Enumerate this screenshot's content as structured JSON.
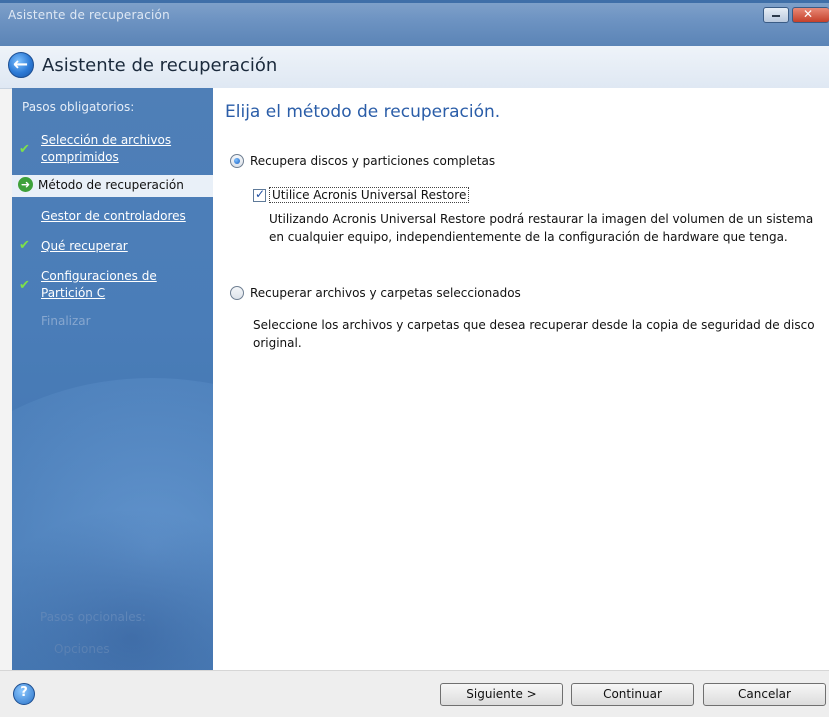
{
  "window": {
    "title": "Asistente de recuperación",
    "header_title": "Asistente de recuperación"
  },
  "sidebar": {
    "heading": "Pasos obligatorios:",
    "steps": [
      {
        "label": "Selección de archivos comprimidos",
        "state": "done"
      },
      {
        "label": "Método de recuperación",
        "state": "current"
      },
      {
        "label": "Gestor de controladores",
        "state": "link"
      },
      {
        "label": "Qué recuperar",
        "state": "done"
      },
      {
        "label": "Configuraciones de Partición C",
        "state": "done"
      },
      {
        "label": "Finalizar",
        "state": "disabled"
      }
    ],
    "optional_heading": "Pasos opcionales:",
    "optional_item": "Opciones"
  },
  "content": {
    "title": "Elija el método de recuperación.",
    "option1": {
      "label": "Recupera discos y particiones completas",
      "selected": true,
      "sub_checkbox": {
        "label": "Utilice Acronis Universal Restore",
        "checked": true,
        "description": "Utilizando Acronis Universal Restore podrá restaurar la imagen del volumen de un sistema en cualquier equipo, independientemente de la configuración de hardware que tenga."
      }
    },
    "option2": {
      "label": "Recuperar archivos y carpetas seleccionados",
      "selected": false,
      "description": "Seleccione los archivos y carpetas que desea recuperar desde la copia de seguridad de disco original."
    }
  },
  "footer": {
    "help_label": "?",
    "next_label": "Siguiente >",
    "continue_label": "Continuar",
    "cancel_label": "Cancelar"
  },
  "colors": {
    "sidebar_blue": "#4a7db8",
    "title_blue": "#2a5da8",
    "check_green": "#7ee04a"
  }
}
